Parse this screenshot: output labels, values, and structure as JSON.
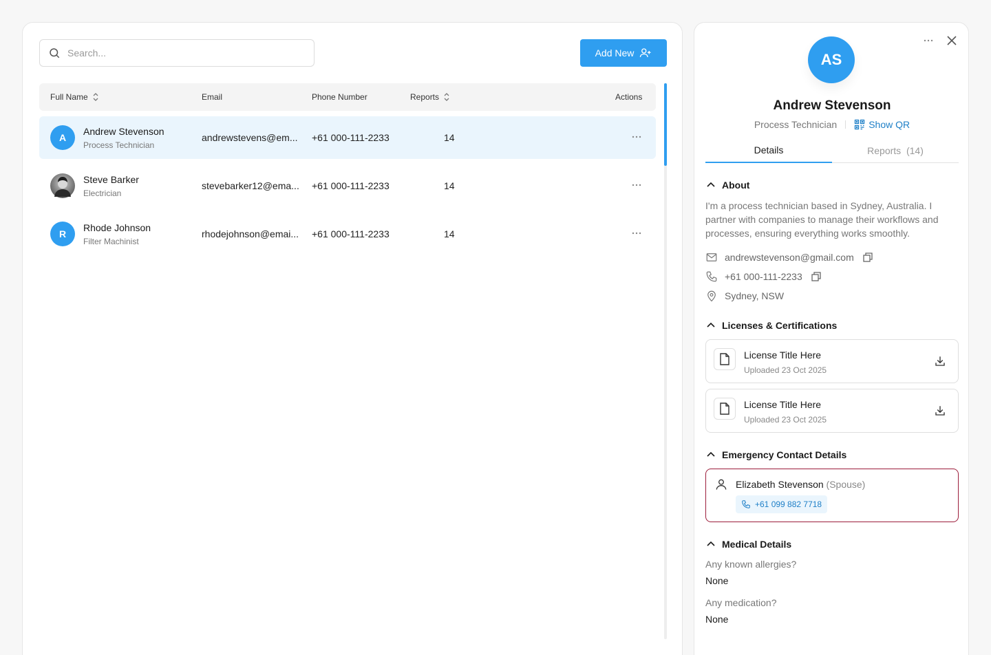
{
  "search": {
    "placeholder": "Search..."
  },
  "toolbar": {
    "add_label": "Add New"
  },
  "table": {
    "headers": {
      "name": "Full Name",
      "email": "Email",
      "phone": "Phone Number",
      "reports": "Reports",
      "actions": "Actions"
    },
    "rows": [
      {
        "initial": "A",
        "name": "Andrew Stevenson",
        "role": "Process Technician",
        "email": "andrewstevens@em...",
        "phone": "+61 000-111-2233",
        "reports": "14",
        "selected": true
      },
      {
        "initial": "",
        "name": "Steve Barker",
        "role": "Electrician",
        "email": "stevebarker12@ema...",
        "phone": "+61 000-111-2233",
        "reports": "14",
        "selected": false
      },
      {
        "initial": "R",
        "name": "Rhode Johnson",
        "role": "Filter Machinist",
        "email": "rhodejohnson@emai...",
        "phone": "+61 000-111-2233",
        "reports": "14",
        "selected": false
      }
    ]
  },
  "detail": {
    "initials": "AS",
    "name": "Andrew Stevenson",
    "role": "Process Technician",
    "show_qr": "Show QR",
    "tabs": {
      "details": "Details",
      "reports": "Reports",
      "reports_count": "(14)"
    },
    "about": {
      "title": "About",
      "text": "I'm a process technician based in Sydney, Australia. I partner with companies to manage their workflows and processes, ensuring everything works smoothly.",
      "email": "andrewstevenson@gmail.com",
      "phone": "+61 000-111-2233",
      "location": "Sydney, NSW"
    },
    "licenses": {
      "title": "Licenses & Certifications",
      "items": [
        {
          "title": "License Title Here",
          "date": "Uploaded 23 Oct 2025"
        },
        {
          "title": "License Title Here",
          "date": "Uploaded 23 Oct 2025"
        }
      ]
    },
    "emergency": {
      "title": "Emergency Contact Details",
      "name": "Elizabeth Stevenson",
      "relation": "(Spouse)",
      "phone": "+61 099 882 7718"
    },
    "medical": {
      "title": "Medical Details",
      "q1": "Any known allergies?",
      "a1": "None",
      "q2": "Any medication?",
      "a2": "None"
    }
  },
  "colors": {
    "accent": "#2f9ef0",
    "link": "#1e7fc7",
    "emergency_border": "#9c1c3a",
    "selected_row": "#eaf5fd"
  }
}
